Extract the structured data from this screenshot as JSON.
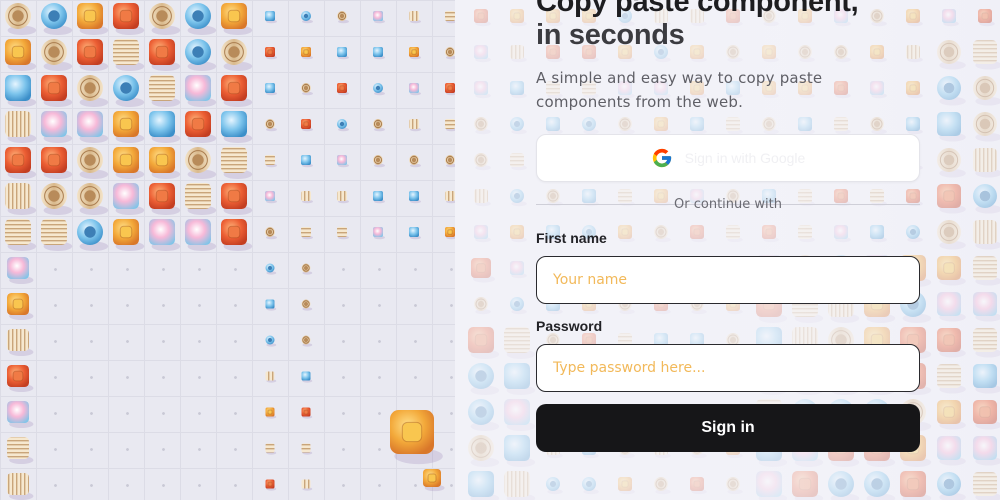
{
  "hero": {
    "title_line1": "Copy paste component,",
    "title_line2": "in seconds",
    "subtitle": "A simple and easy way to copy paste components from the web."
  },
  "oauth": {
    "google_label": "Sign in with Google",
    "google_icon": "google-g-icon"
  },
  "divider": {
    "text": "Or continue with"
  },
  "fields": {
    "first_name": {
      "label": "First name",
      "placeholder": "Your name",
      "value": ""
    },
    "password": {
      "label": "Password",
      "placeholder": "Type password here...",
      "value": ""
    }
  },
  "submit": {
    "label": "Sign in"
  },
  "colors": {
    "accent_black": "#161618",
    "placeholder_orange": "#f2b95a",
    "panel_bg": "#e9e9f1"
  }
}
